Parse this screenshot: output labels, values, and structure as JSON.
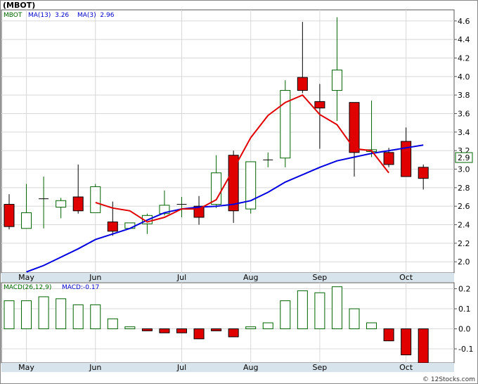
{
  "title": "(MBOT)",
  "footer": "© 12Stocks.com",
  "price_panel": {
    "legend_symbol": "MBOT",
    "legend_ma13": "MA(13)  3.26",
    "legend_ma3": "MA(3)  2.96",
    "last_price_label": "2.9"
  },
  "macd_panel": {
    "legend_name": "MACD(26,12,9)",
    "legend_value": "MACD:-0.17"
  },
  "colors": {
    "up_fill": "#ffffff",
    "up_stroke": "#006400",
    "down_fill": "#e00000",
    "ma13": "#0000e0",
    "ma3": "#e00000",
    "axis_band": "#d8e4ec",
    "legend_green": "#006400",
    "legend_blue": "#0000cc",
    "macd_bar": "#006400",
    "macd_neg": "#e00000"
  },
  "chart_data": [
    {
      "type": "candlestick",
      "title": "(MBOT)",
      "x_tick_labels": [
        "May",
        "Jun",
        "Jul",
        "Aug",
        "Sep",
        "Oct"
      ],
      "x_tick_index": [
        1,
        5,
        10,
        14,
        18,
        23
      ],
      "y_ticks": [
        2.0,
        2.2,
        2.4,
        2.6,
        2.8,
        3.0,
        3.2,
        3.4,
        3.6,
        3.8,
        4.0,
        4.2,
        4.4,
        4.6
      ],
      "ylim": [
        1.88,
        4.72
      ],
      "candles": [
        {
          "o": 2.62,
          "h": 2.73,
          "l": 2.35,
          "c": 2.38
        },
        {
          "o": 2.36,
          "h": 2.84,
          "l": 2.36,
          "c": 2.53
        },
        {
          "o": 2.68,
          "h": 2.92,
          "l": 2.36,
          "c": 2.68
        },
        {
          "o": 2.59,
          "h": 2.69,
          "l": 2.47,
          "c": 2.66
        },
        {
          "o": 2.7,
          "h": 3.05,
          "l": 2.52,
          "c": 2.55
        },
        {
          "o": 2.53,
          "h": 2.84,
          "l": 2.53,
          "c": 2.81
        },
        {
          "o": 2.43,
          "h": 2.65,
          "l": 2.28,
          "c": 2.33
        },
        {
          "o": 2.36,
          "h": 2.42,
          "l": 2.36,
          "c": 2.42
        },
        {
          "o": 2.41,
          "h": 2.52,
          "l": 2.3,
          "c": 2.5
        },
        {
          "o": 2.52,
          "h": 2.77,
          "l": 2.5,
          "c": 2.61
        },
        {
          "o": 2.61,
          "h": 2.7,
          "l": 2.48,
          "c": 2.62
        },
        {
          "o": 2.6,
          "h": 2.71,
          "l": 2.4,
          "c": 2.48
        },
        {
          "o": 2.62,
          "h": 3.15,
          "l": 2.58,
          "c": 2.96
        },
        {
          "o": 3.15,
          "h": 3.2,
          "l": 2.42,
          "c": 2.55
        },
        {
          "o": 2.57,
          "h": 3.08,
          "l": 2.52,
          "c": 3.08
        },
        {
          "o": 3.1,
          "h": 3.18,
          "l": 3.02,
          "c": 3.1
        },
        {
          "o": 3.12,
          "h": 3.96,
          "l": 3.02,
          "c": 3.85
        },
        {
          "o": 3.99,
          "h": 4.59,
          "l": 3.82,
          "c": 3.85
        },
        {
          "o": 3.73,
          "h": 3.92,
          "l": 3.22,
          "c": 3.66
        },
        {
          "o": 3.85,
          "h": 4.64,
          "l": 3.52,
          "c": 4.07
        },
        {
          "o": 3.72,
          "h": 3.72,
          "l": 2.92,
          "c": 3.18
        },
        {
          "o": 3.19,
          "h": 3.74,
          "l": 3.13,
          "c": 3.21
        },
        {
          "o": 3.18,
          "h": 3.23,
          "l": 3.02,
          "c": 3.05
        },
        {
          "o": 3.3,
          "h": 3.45,
          "l": 2.92,
          "c": 2.92
        },
        {
          "o": 3.02,
          "h": 3.05,
          "l": 2.78,
          "c": 2.9
        }
      ],
      "series": [
        {
          "legend": "MA(13)",
          "index_start": 1,
          "values": [
            1.89,
            1.96,
            2.05,
            2.14,
            2.24,
            2.3,
            2.36,
            2.45,
            2.53,
            2.57,
            2.59,
            2.6,
            2.62,
            2.66,
            2.75,
            2.86,
            2.94,
            3.02,
            3.09,
            3.13,
            3.17,
            3.2,
            3.23,
            3.26
          ]
        },
        {
          "legend": "MA(3)",
          "index_start": 5,
          "values": [
            2.64,
            2.58,
            2.55,
            2.43,
            2.48,
            2.57,
            2.57,
            2.67,
            3.0,
            3.34,
            3.58,
            3.72,
            3.8,
            3.59,
            3.48,
            3.22,
            3.2,
            2.96
          ]
        }
      ]
    },
    {
      "type": "bar",
      "title": "MACD(26,12,9)",
      "y_ticks": [
        -0.1,
        0.0,
        0.1,
        0.2
      ],
      "ylim": [
        -0.17,
        0.23
      ],
      "values": [
        0.14,
        0.14,
        0.16,
        0.15,
        0.12,
        0.12,
        0.05,
        0.01,
        -0.01,
        -0.02,
        -0.02,
        -0.05,
        -0.01,
        -0.04,
        0.01,
        0.03,
        0.14,
        0.19,
        0.18,
        0.21,
        0.1,
        0.03,
        -0.06,
        -0.13,
        -0.17
      ]
    }
  ]
}
